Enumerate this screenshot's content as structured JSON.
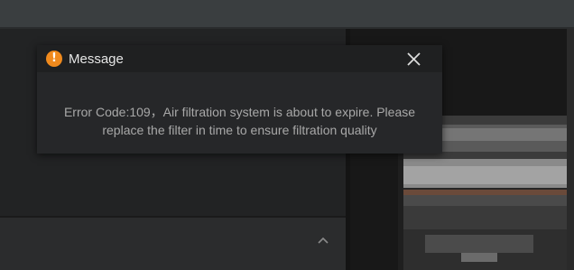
{
  "dialog": {
    "title": "Message",
    "icon": "warning-icon",
    "icon_glyph": "!",
    "icon_color": "#f08a1d",
    "close_icon": "close-icon",
    "message": "Error Code:109，Air filtration system is about to expire. Please replace the filter in time to ensure filtration quality"
  },
  "left_panel": {
    "collapse_icon": "chevron-up-icon"
  },
  "colors": {
    "background": "#1a1a1a",
    "top_bar": "#3a3e40",
    "dialog_body": "#262729",
    "dialog_header": "#1f2021",
    "message_text": "#a8a8a8"
  }
}
